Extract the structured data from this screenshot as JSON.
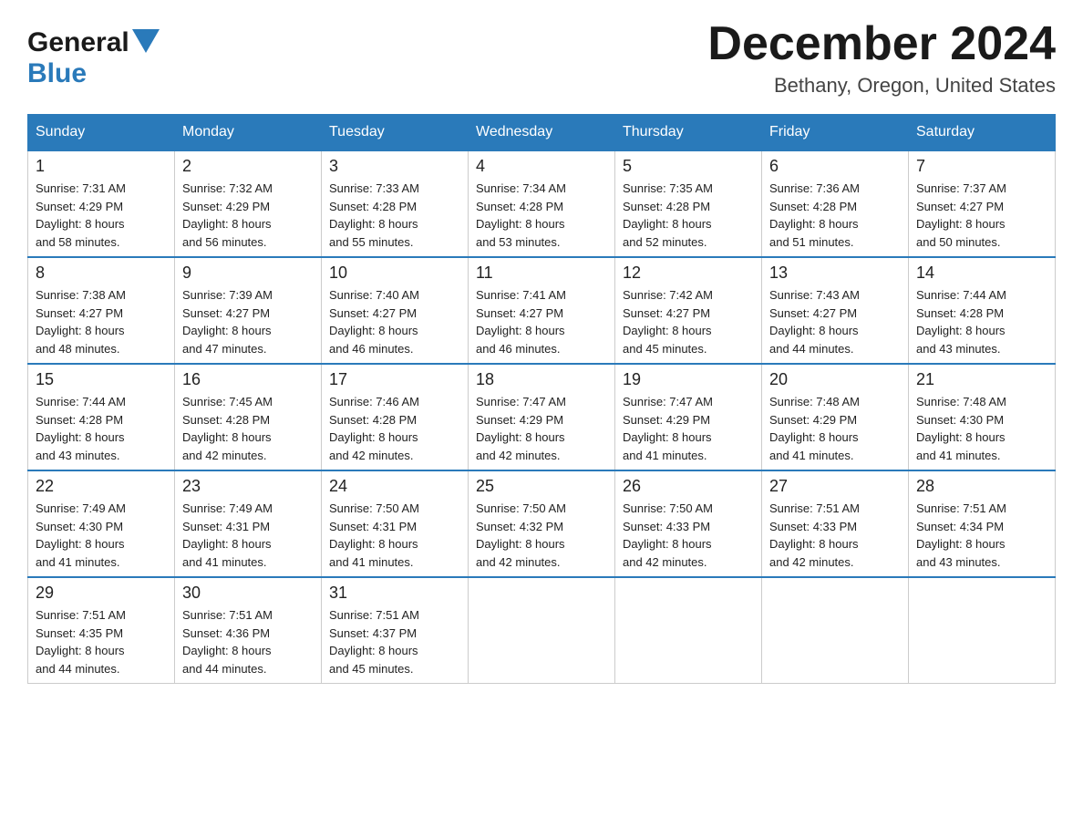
{
  "header": {
    "logo_line1": "General",
    "logo_line2": "Blue",
    "title": "December 2024",
    "location": "Bethany, Oregon, United States"
  },
  "days_of_week": [
    "Sunday",
    "Monday",
    "Tuesday",
    "Wednesday",
    "Thursday",
    "Friday",
    "Saturday"
  ],
  "weeks": [
    [
      {
        "day": "1",
        "sunrise": "7:31 AM",
        "sunset": "4:29 PM",
        "daylight": "8 hours and 58 minutes."
      },
      {
        "day": "2",
        "sunrise": "7:32 AM",
        "sunset": "4:29 PM",
        "daylight": "8 hours and 56 minutes."
      },
      {
        "day": "3",
        "sunrise": "7:33 AM",
        "sunset": "4:28 PM",
        "daylight": "8 hours and 55 minutes."
      },
      {
        "day": "4",
        "sunrise": "7:34 AM",
        "sunset": "4:28 PM",
        "daylight": "8 hours and 53 minutes."
      },
      {
        "day": "5",
        "sunrise": "7:35 AM",
        "sunset": "4:28 PM",
        "daylight": "8 hours and 52 minutes."
      },
      {
        "day": "6",
        "sunrise": "7:36 AM",
        "sunset": "4:28 PM",
        "daylight": "8 hours and 51 minutes."
      },
      {
        "day": "7",
        "sunrise": "7:37 AM",
        "sunset": "4:27 PM",
        "daylight": "8 hours and 50 minutes."
      }
    ],
    [
      {
        "day": "8",
        "sunrise": "7:38 AM",
        "sunset": "4:27 PM",
        "daylight": "8 hours and 48 minutes."
      },
      {
        "day": "9",
        "sunrise": "7:39 AM",
        "sunset": "4:27 PM",
        "daylight": "8 hours and 47 minutes."
      },
      {
        "day": "10",
        "sunrise": "7:40 AM",
        "sunset": "4:27 PM",
        "daylight": "8 hours and 46 minutes."
      },
      {
        "day": "11",
        "sunrise": "7:41 AM",
        "sunset": "4:27 PM",
        "daylight": "8 hours and 46 minutes."
      },
      {
        "day": "12",
        "sunrise": "7:42 AM",
        "sunset": "4:27 PM",
        "daylight": "8 hours and 45 minutes."
      },
      {
        "day": "13",
        "sunrise": "7:43 AM",
        "sunset": "4:27 PM",
        "daylight": "8 hours and 44 minutes."
      },
      {
        "day": "14",
        "sunrise": "7:44 AM",
        "sunset": "4:28 PM",
        "daylight": "8 hours and 43 minutes."
      }
    ],
    [
      {
        "day": "15",
        "sunrise": "7:44 AM",
        "sunset": "4:28 PM",
        "daylight": "8 hours and 43 minutes."
      },
      {
        "day": "16",
        "sunrise": "7:45 AM",
        "sunset": "4:28 PM",
        "daylight": "8 hours and 42 minutes."
      },
      {
        "day": "17",
        "sunrise": "7:46 AM",
        "sunset": "4:28 PM",
        "daylight": "8 hours and 42 minutes."
      },
      {
        "day": "18",
        "sunrise": "7:47 AM",
        "sunset": "4:29 PM",
        "daylight": "8 hours and 42 minutes."
      },
      {
        "day": "19",
        "sunrise": "7:47 AM",
        "sunset": "4:29 PM",
        "daylight": "8 hours and 41 minutes."
      },
      {
        "day": "20",
        "sunrise": "7:48 AM",
        "sunset": "4:29 PM",
        "daylight": "8 hours and 41 minutes."
      },
      {
        "day": "21",
        "sunrise": "7:48 AM",
        "sunset": "4:30 PM",
        "daylight": "8 hours and 41 minutes."
      }
    ],
    [
      {
        "day": "22",
        "sunrise": "7:49 AM",
        "sunset": "4:30 PM",
        "daylight": "8 hours and 41 minutes."
      },
      {
        "day": "23",
        "sunrise": "7:49 AM",
        "sunset": "4:31 PM",
        "daylight": "8 hours and 41 minutes."
      },
      {
        "day": "24",
        "sunrise": "7:50 AM",
        "sunset": "4:31 PM",
        "daylight": "8 hours and 41 minutes."
      },
      {
        "day": "25",
        "sunrise": "7:50 AM",
        "sunset": "4:32 PM",
        "daylight": "8 hours and 42 minutes."
      },
      {
        "day": "26",
        "sunrise": "7:50 AM",
        "sunset": "4:33 PM",
        "daylight": "8 hours and 42 minutes."
      },
      {
        "day": "27",
        "sunrise": "7:51 AM",
        "sunset": "4:33 PM",
        "daylight": "8 hours and 42 minutes."
      },
      {
        "day": "28",
        "sunrise": "7:51 AM",
        "sunset": "4:34 PM",
        "daylight": "8 hours and 43 minutes."
      }
    ],
    [
      {
        "day": "29",
        "sunrise": "7:51 AM",
        "sunset": "4:35 PM",
        "daylight": "8 hours and 44 minutes."
      },
      {
        "day": "30",
        "sunrise": "7:51 AM",
        "sunset": "4:36 PM",
        "daylight": "8 hours and 44 minutes."
      },
      {
        "day": "31",
        "sunrise": "7:51 AM",
        "sunset": "4:37 PM",
        "daylight": "8 hours and 45 minutes."
      },
      null,
      null,
      null,
      null
    ]
  ],
  "labels": {
    "sunrise_prefix": "Sunrise: ",
    "sunset_prefix": "Sunset: ",
    "daylight_prefix": "Daylight: "
  }
}
